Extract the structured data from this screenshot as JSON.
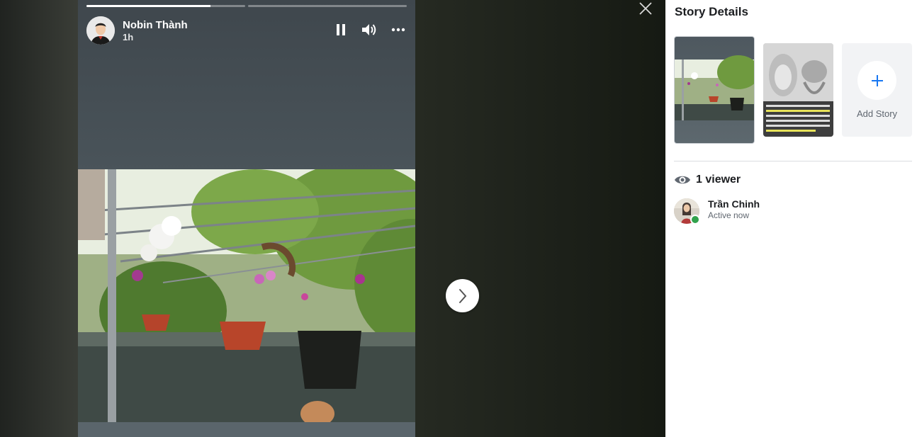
{
  "story": {
    "progress": [
      0.78,
      0.0
    ],
    "author_name": "Nobin Thành",
    "time": "1h",
    "controls": {
      "pause": "pause-icon",
      "volume": "volume-icon",
      "more": "more-icon"
    }
  },
  "navigation": {
    "next": "chevron-right-icon",
    "close": "close-icon"
  },
  "panel": {
    "title": "Story Details",
    "add_story_label": "Add Story",
    "viewers_label": "1 viewer",
    "viewers": [
      {
        "name": "Trần Chinh",
        "status": "Active now"
      }
    ]
  },
  "colors": {
    "accent": "#1877f2",
    "online": "#31a24c"
  }
}
